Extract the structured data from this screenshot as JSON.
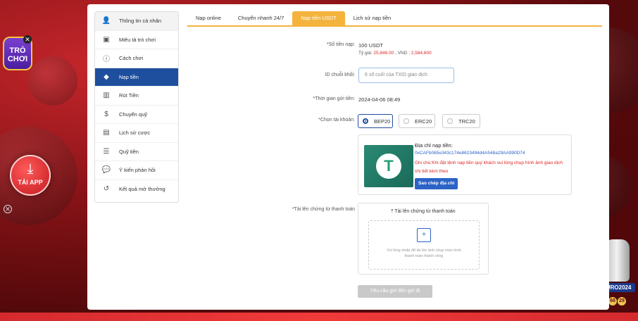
{
  "floating": {
    "tro_choi": "TRÒ CHƠI",
    "tai_app": "TẢI APP",
    "euro": "EURO2024",
    "euro_balls": [
      "68",
      "29"
    ]
  },
  "sidebar": {
    "items": [
      {
        "label": "Thông tin cá nhân",
        "icon": "user-icon"
      },
      {
        "label": "Miêu tả trò chơi",
        "icon": "gamepad-icon"
      },
      {
        "label": "Cách chơi",
        "icon": "info-icon"
      },
      {
        "label": "Nạp tiền",
        "icon": "piggy-bank-icon"
      },
      {
        "label": "Rút Tiền",
        "icon": "cash-icon"
      },
      {
        "label": "Chuyển quỹ",
        "icon": "dollar-icon"
      },
      {
        "label": "Lịch sử cược",
        "icon": "receipt-icon"
      },
      {
        "label": "Quỹ tiền",
        "icon": "fund-icon"
      },
      {
        "label": "Ý kiến phản hồi",
        "icon": "chat-icon"
      },
      {
        "label": "Kết quả mở thưởng",
        "icon": "history-icon"
      }
    ],
    "active_index": 3
  },
  "tabs": [
    "Nạp online",
    "Chuyển nhanh 24/7",
    "Nạp tiền USDT",
    "Lịch sử nạp tiền"
  ],
  "form": {
    "amount_label": "*Số tiền nạp:",
    "amount_value": "100 USDT",
    "rate_prefix": "Tỷ giá:",
    "rate_value": "25,846.00",
    "rate_vnd_prefix": ", VND :",
    "rate_vnd_value": "2,584,600",
    "chain_label": "ID chuỗi khối:",
    "chain_placeholder": "6 số cuối của TXID giao dịch",
    "time_label": "*Thời gian gửi tiền:",
    "time_value": "2024-04-06 08:49",
    "account_label": "*Chọn tài khoản:",
    "accounts": [
      "BEP20",
      "ERC20",
      "TRC20"
    ],
    "selected_account": "BEP20",
    "addr_title": "Địa chỉ nạp tiền:",
    "addr_value": "0xCAFb065e343c174e8623494d4A548a29AA990D74",
    "addr_note": "Ghi chú:Khi đặt lệnh nạp tiền quý khách vui lòng chụp hình ảnh giao dịch chi tiết kèm theo",
    "copy_label": "Sao chép địa chỉ",
    "upload_label": "*Tải lên chứng từ thanh toán",
    "upload_title": "Tải lên chứng từ thanh toán",
    "upload_hint": "Vui lòng nhấp để tải lên ảnh chụp màn hình thanh toán thành công",
    "submit_label": "Yêu cầu gửi tiền gửi đi"
  }
}
